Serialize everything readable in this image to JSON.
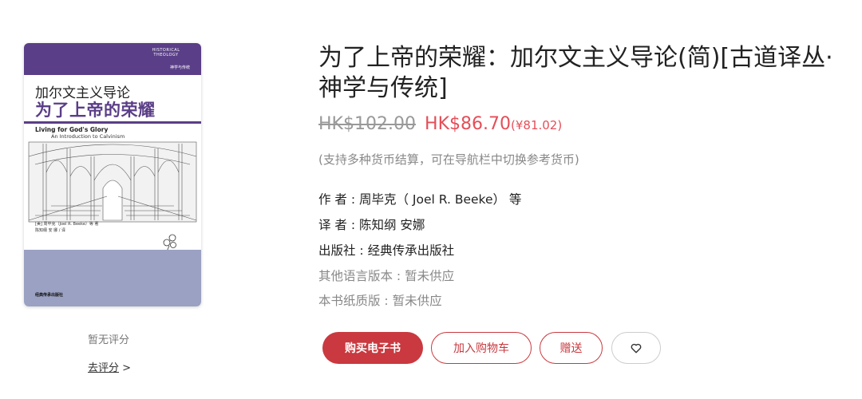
{
  "cover": {
    "band_text": "HISTORICAL THEOLOGY",
    "band_sub": "神学与传统",
    "title_cn_line1": "加尔文主义导论",
    "title_cn_line2": "为了上帝的荣耀",
    "title_en": "Living for God's Glory",
    "subtitle_en": "An Introduction to Calvinism",
    "authors_line1": "[美] 周毕克（Joel R. Beeke）等 著",
    "authors_line2": "陈知纲 安 娜 / 译",
    "publisher": "经典传承出版社"
  },
  "rating": {
    "text": "暂无评分",
    "link": "去评分",
    "arrow": ">"
  },
  "book": {
    "title": "为了上帝的荣耀：加尔文主义导论(简)[古道译丛·神学与传统]",
    "old_price": "HK$102.00",
    "new_price": "HK$86.70",
    "ref_price": "(¥81.02)",
    "currency_note": "(支持多种货币结算，可在导航栏中切换参考货币)",
    "author": "作 者 : 周毕克（ Joel R. Beeke） 等",
    "translator": "译 者 : 陈知纲 安娜",
    "publisher": "出版社 : 经典传承出版社",
    "other_lang": "其他语言版本 : 暂未供应",
    "paper_edition": "本书纸质版 : 暂未供应"
  },
  "actions": {
    "buy": "购买电子书",
    "cart": "加入购物车",
    "gift": "赠送",
    "favorite_icon": "heart-icon"
  },
  "colors": {
    "accent": "#c9393f",
    "price": "#e54e58",
    "cover_purple": "#5a3e87",
    "cover_bottom": "#9aa1c2"
  }
}
